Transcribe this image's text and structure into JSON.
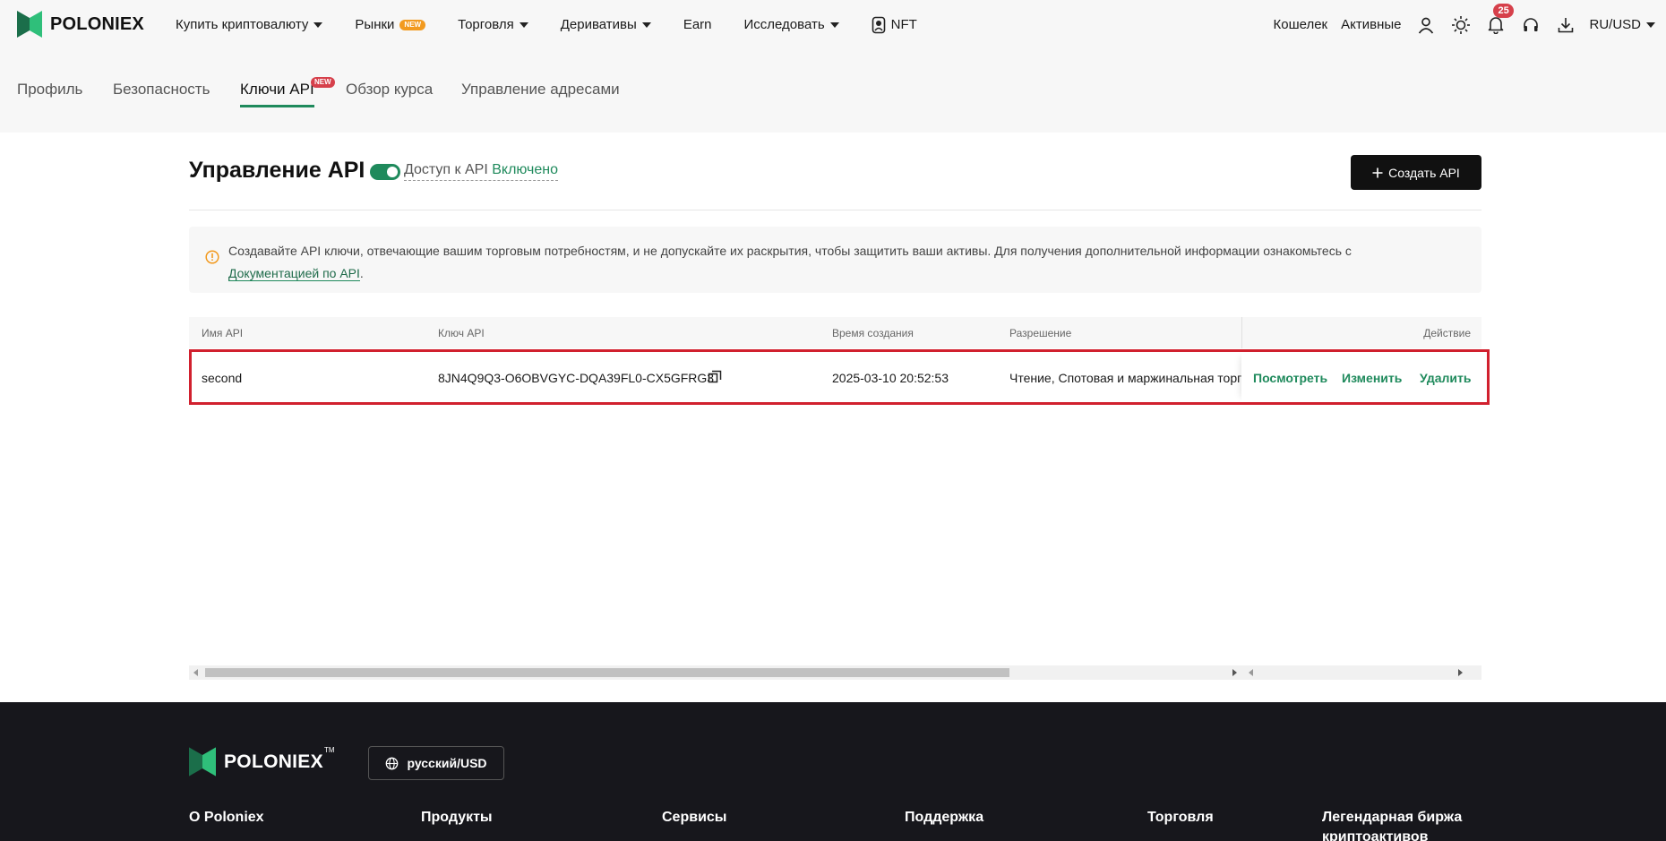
{
  "brand": {
    "name": "POLONIEX",
    "accent": "#1f8a5c",
    "logo_green_light": "#2fbf7a",
    "logo_green_dark": "#1b6e4a"
  },
  "topnav": {
    "items": [
      {
        "label": "Купить криптовалюту",
        "caret": true
      },
      {
        "label": "Рынки",
        "badge": "NEW"
      },
      {
        "label": "Торговля",
        "caret": true
      },
      {
        "label": "Деривативы",
        "caret": true
      },
      {
        "label": "Earn"
      },
      {
        "label": "Исследовать",
        "caret": true
      },
      {
        "label": "NFT",
        "icon": "nft-icon"
      }
    ],
    "right": {
      "wallet": "Кошелек",
      "assets": "Активные",
      "notifications_count": "25",
      "locale": "RU/USD",
      "icons": [
        "user-icon",
        "sun-icon",
        "bell-icon",
        "headset-icon",
        "download-icon"
      ]
    }
  },
  "subtabs": [
    {
      "label": "Профиль",
      "active": false
    },
    {
      "label": "Безопасность",
      "active": false
    },
    {
      "label": "Ключи API",
      "active": true,
      "badge": "NEW"
    },
    {
      "label": "Обзор курса",
      "active": false
    },
    {
      "label": "Управление адресами",
      "active": false
    }
  ],
  "main": {
    "title": "Управление API",
    "api_access_label": "Доступ к API",
    "api_access_state": "Включено",
    "api_access_enabled": true,
    "create_button": "Создать API",
    "info_text": "Создавайте API ключи, отвечающие вашим торговым потребностям, и не допускайте их раскрытия, чтобы защитить ваши активы. Для получения дополнительной информации ознакомьтесь с",
    "info_link": "Документацией по API",
    "info_end": "."
  },
  "table": {
    "headers": {
      "name": "Имя API",
      "key": "Ключ API",
      "created": "Время создания",
      "permission": "Разрешение",
      "action": "Действие"
    },
    "rows": [
      {
        "name": "second",
        "key": "8JN4Q9Q3-O6OBVGYC-DQA39FL0-CX5GFRG3",
        "created": "2025-03-10 20:52:53",
        "permission": "Чтение, Спотовая и маржинальная торговля",
        "actions": {
          "view": "Посмотреть",
          "edit": "Изменить",
          "delete": "Удалить"
        }
      }
    ]
  },
  "footer": {
    "brand": "POLONIEX",
    "trademark": "TM",
    "language_button": "русский/USD",
    "columns": [
      "О Poloniex",
      "Продукты",
      "Сервисы",
      "Поддержка",
      "Торговля",
      "Легендарная биржа криптоактивов"
    ]
  }
}
